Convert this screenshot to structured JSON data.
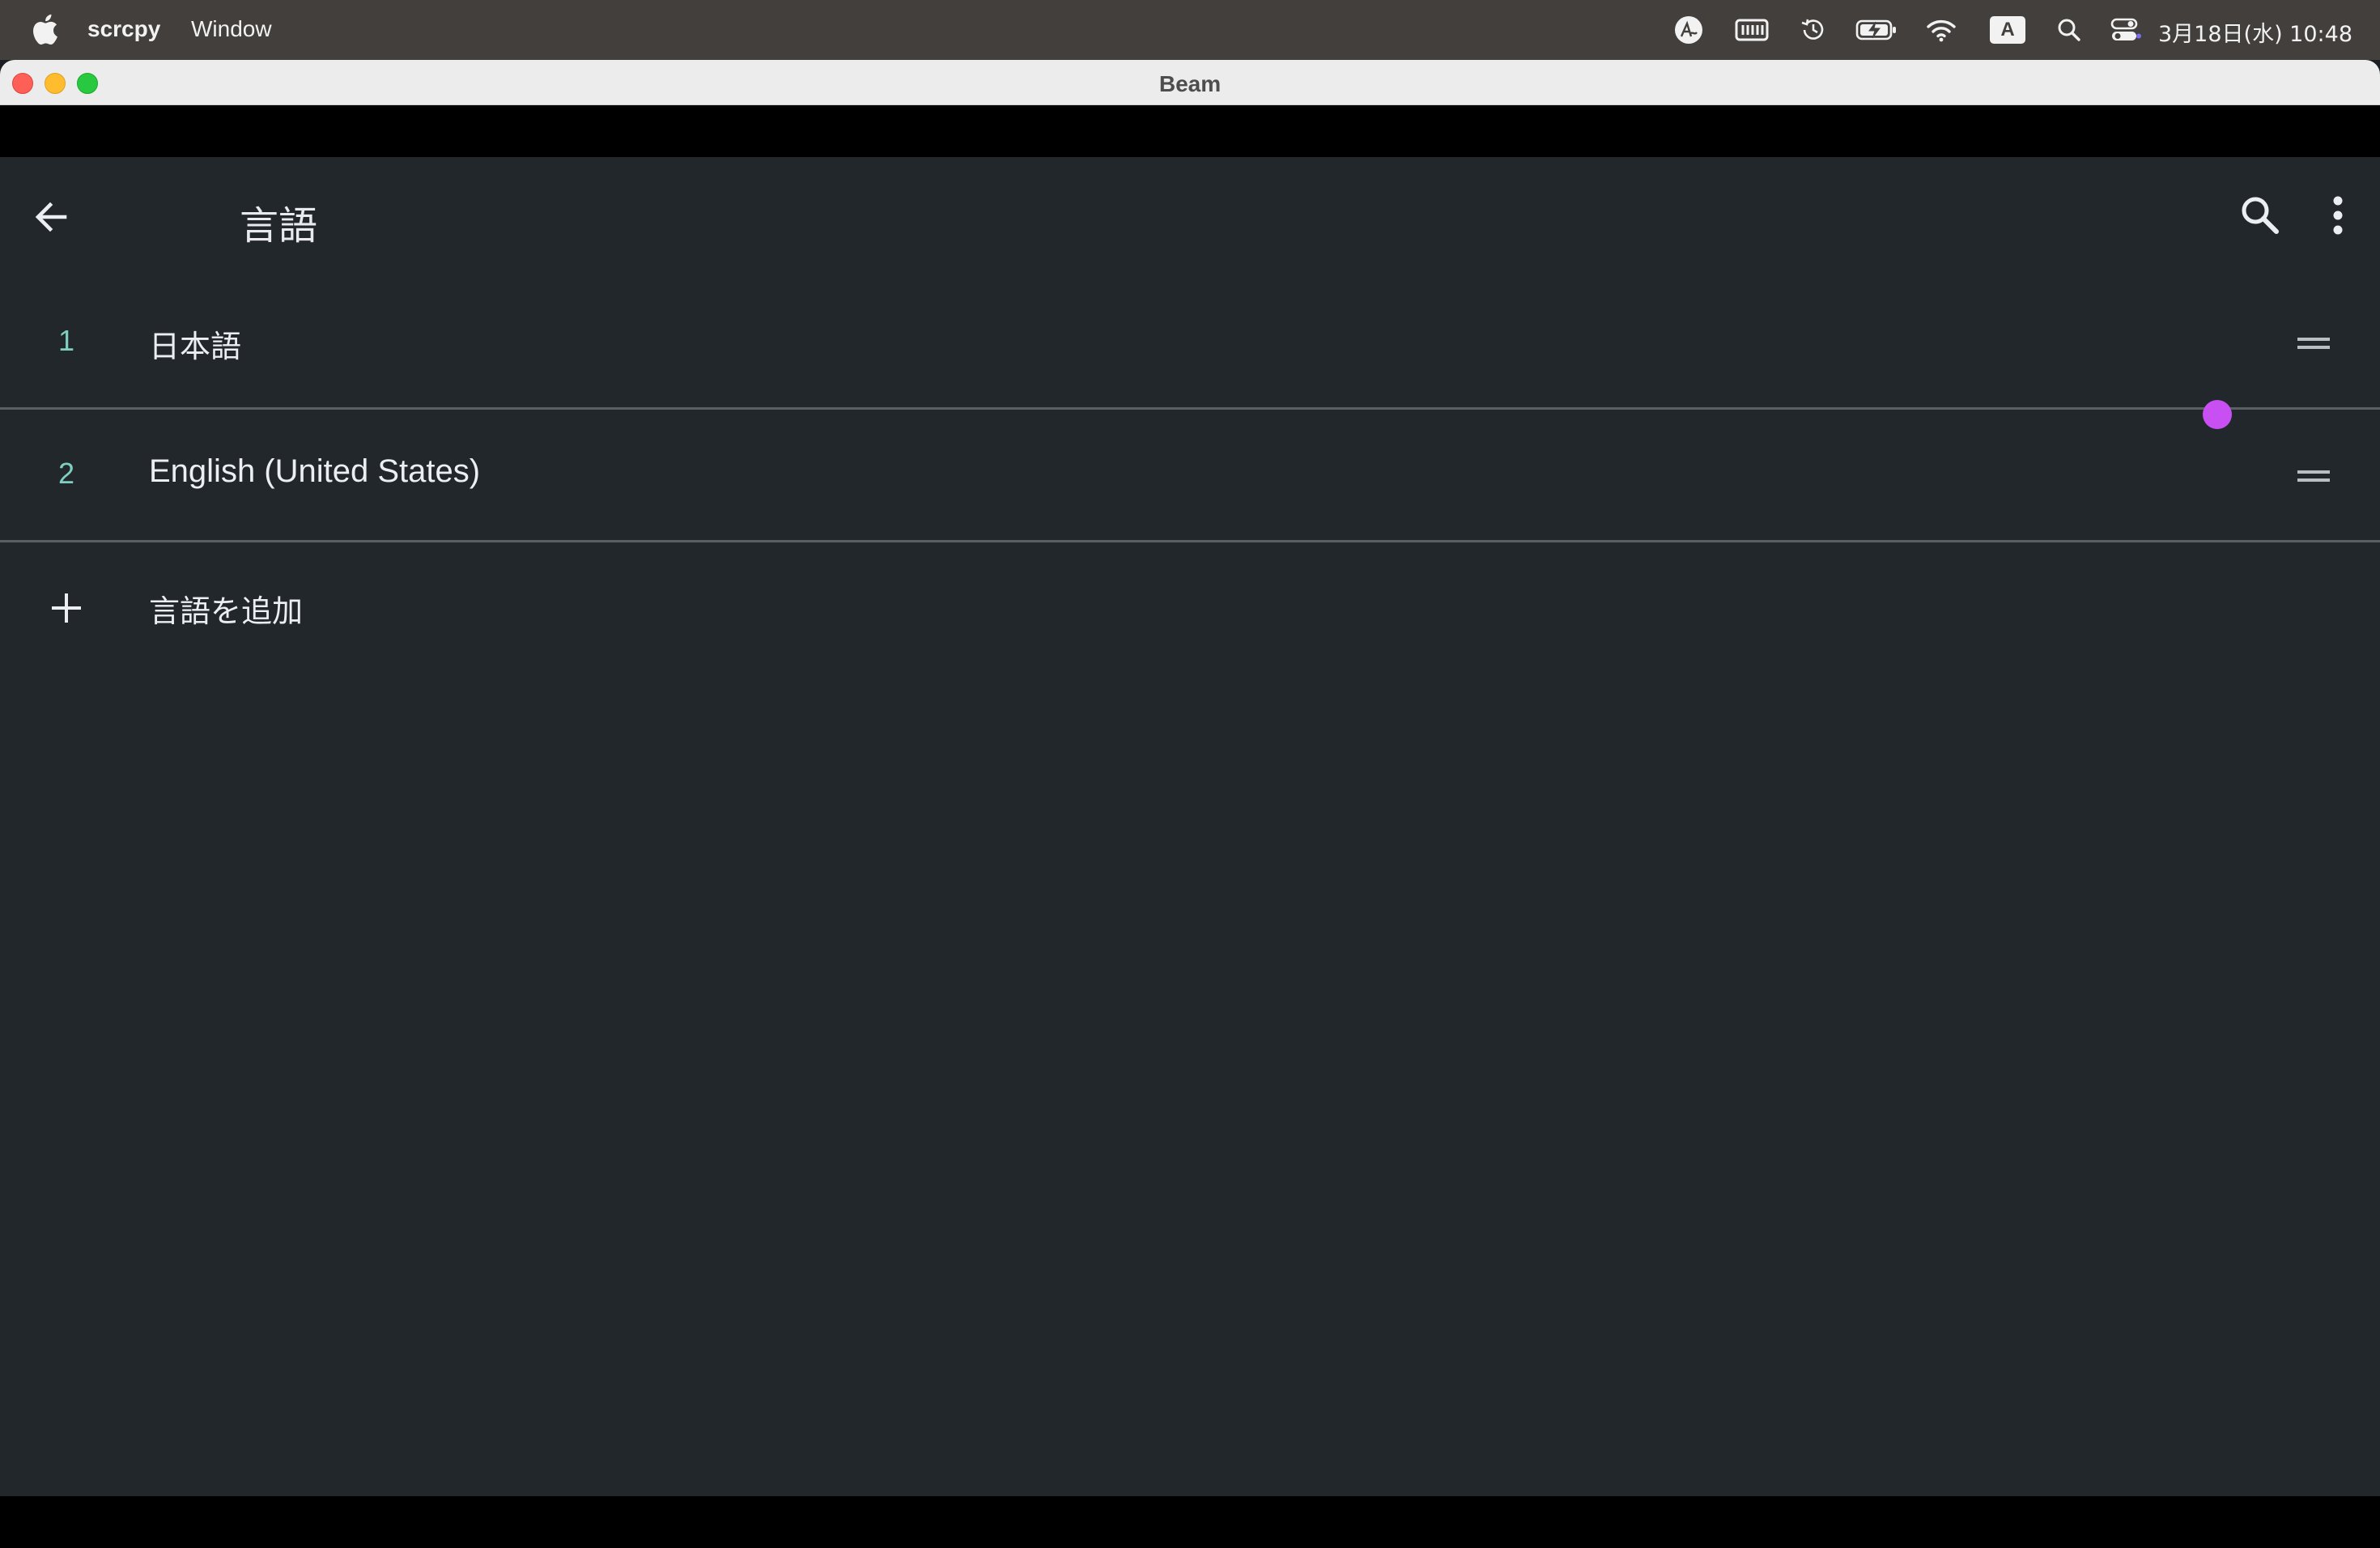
{
  "menubar": {
    "app_name": "scrcpy",
    "menus": [
      "Window"
    ],
    "status_icons": [
      "writing-tools-icon",
      "keyboard-icon",
      "time-machine-icon",
      "battery-charging-icon",
      "wifi-icon",
      "input-source-icon",
      "spotlight-search-icon",
      "control-center-icon"
    ],
    "input_source": "A",
    "clock": "3月18日(水) 10:48"
  },
  "window": {
    "title": "Beam"
  },
  "android": {
    "appbar": {
      "title": "言語"
    },
    "languages": [
      {
        "index": "1",
        "name": "日本語"
      },
      {
        "index": "2",
        "name": "English (United States)"
      }
    ],
    "add_language_label": "言語を追加",
    "accent_color": "#7fcfc0",
    "touch_indicator_color": "#c84ff2"
  }
}
